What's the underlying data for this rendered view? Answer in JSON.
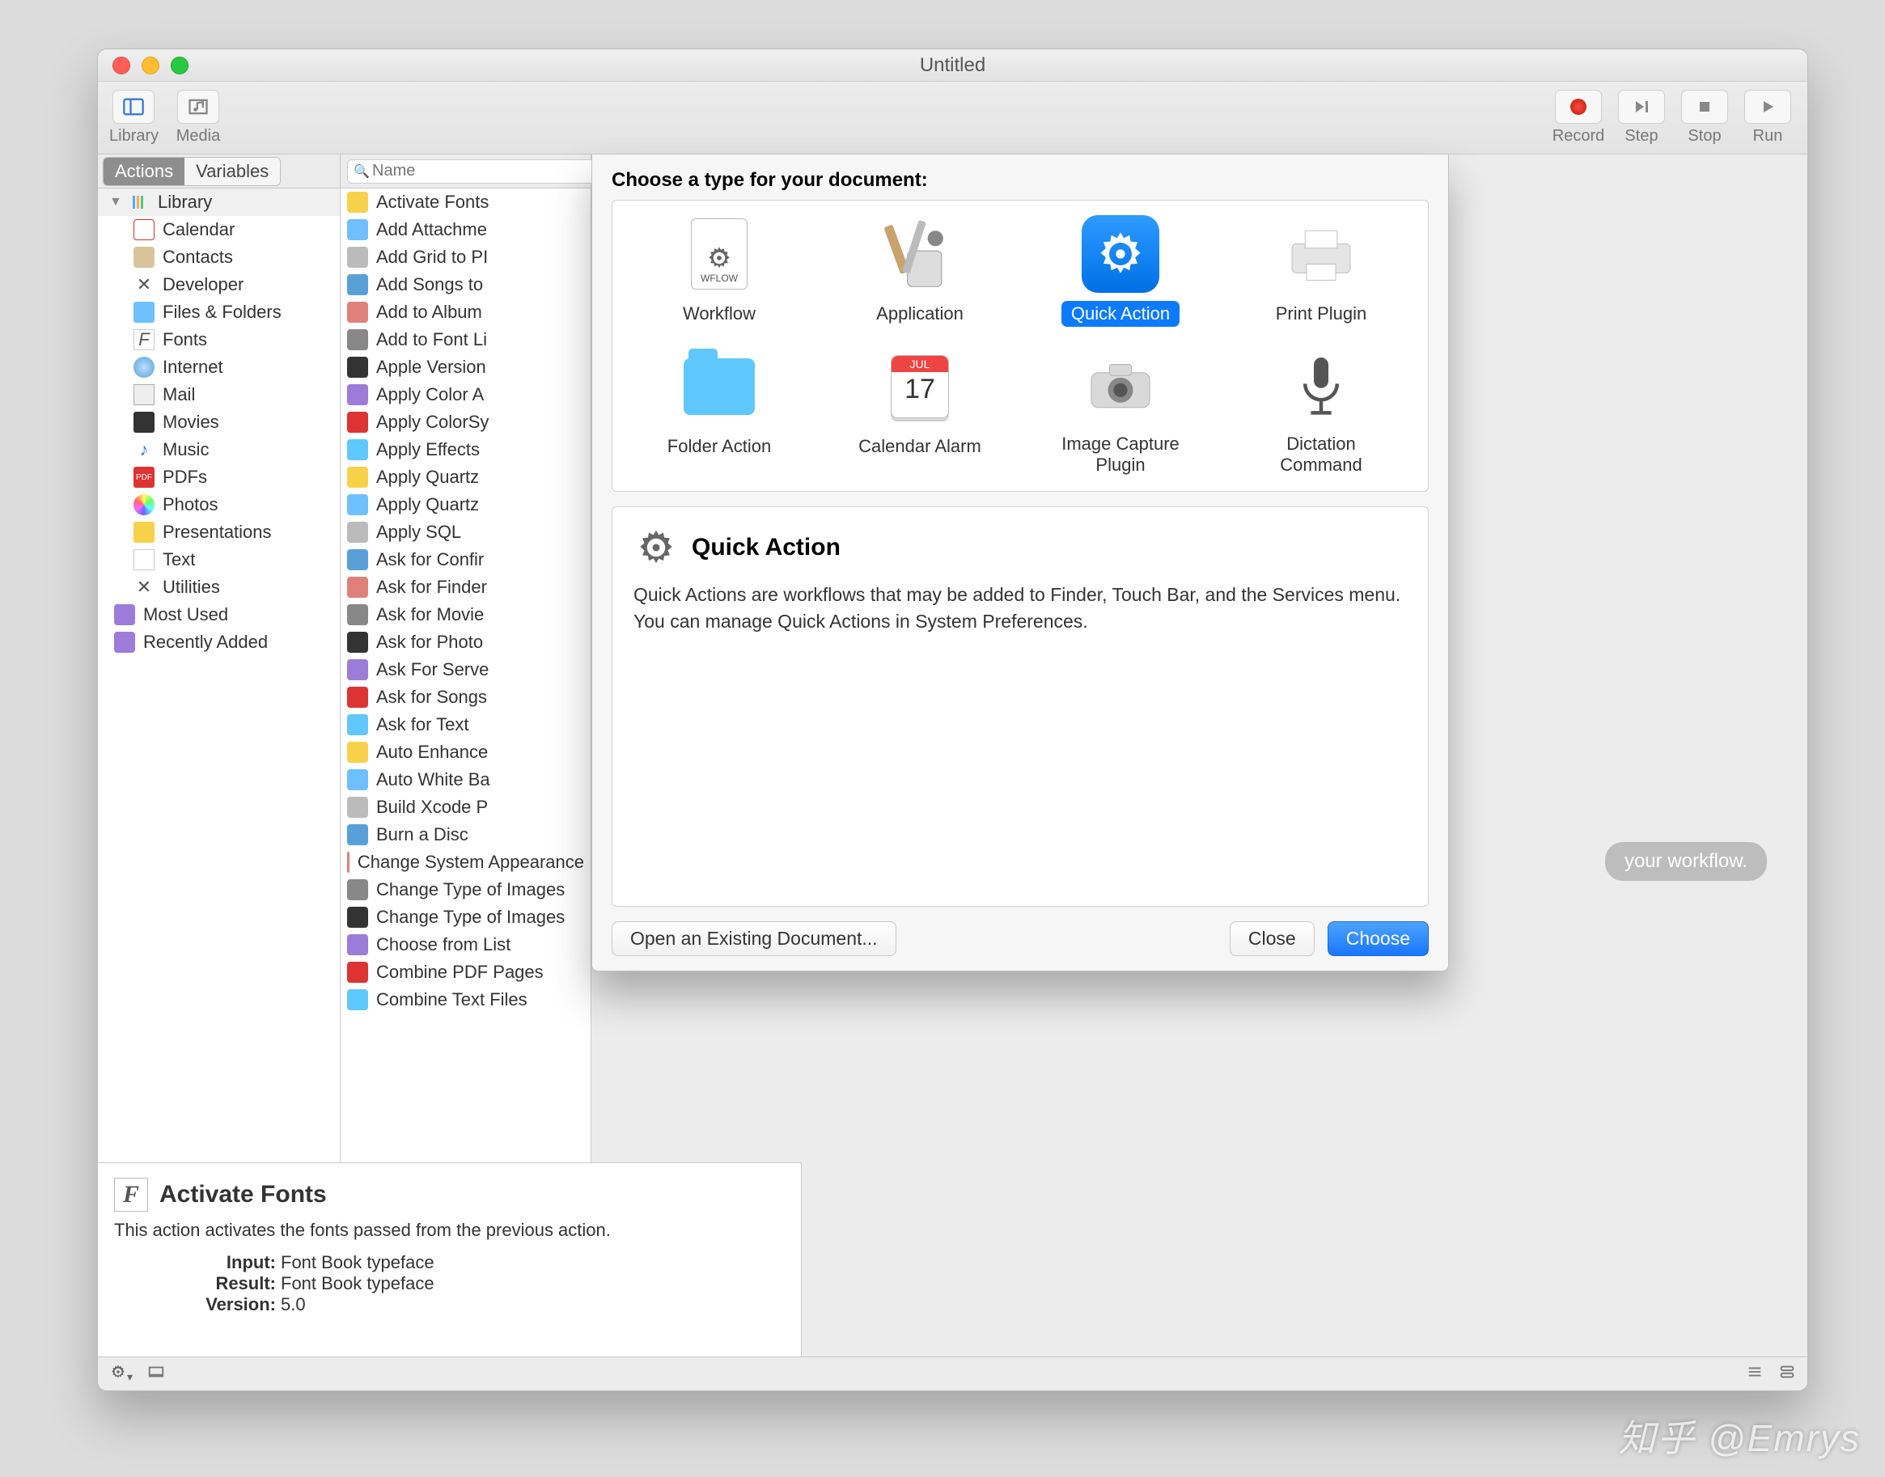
{
  "window": {
    "title": "Untitled"
  },
  "toolbar": {
    "library": "Library",
    "media": "Media",
    "record": "Record",
    "step": "Step",
    "stop": "Stop",
    "run": "Run"
  },
  "segtabs": {
    "actions": "Actions",
    "variables": "Variables"
  },
  "search": {
    "placeholder": "Name"
  },
  "library_tree": {
    "root": "Library",
    "items": [
      "Calendar",
      "Contacts",
      "Developer",
      "Files & Folders",
      "Fonts",
      "Internet",
      "Mail",
      "Movies",
      "Music",
      "PDFs",
      "Photos",
      "Presentations",
      "Text",
      "Utilities"
    ],
    "most_used": "Most Used",
    "recently_added": "Recently Added"
  },
  "actions_list": [
    "Activate Fonts",
    "Add Attachme",
    "Add Grid to PI",
    "Add Songs to",
    "Add to Album",
    "Add to Font Li",
    "Apple Version",
    "Apply Color A",
    "Apply ColorSy",
    "Apply Effects",
    "Apply Quartz",
    "Apply Quartz",
    "Apply SQL",
    "Ask for Confir",
    "Ask for Finder",
    "Ask for Movie",
    "Ask for Photo",
    "Ask For Serve",
    "Ask for Songs",
    "Ask for Text",
    "Auto Enhance",
    "Auto White Ba",
    "Build Xcode P",
    "Burn a Disc",
    "Change System Appearance",
    "Change Type of Images",
    "Change Type of Images",
    "Choose from List",
    "Combine PDF Pages",
    "Combine Text Files"
  ],
  "canvas": {
    "hint": "your workflow."
  },
  "info": {
    "title": "Activate Fonts",
    "desc": "This action activates the fonts passed from the previous action.",
    "input_label": "Input:",
    "input_value": "Font Book typeface",
    "result_label": "Result:",
    "result_value": "Font Book typeface",
    "version_label": "Version:",
    "version_value": "5.0"
  },
  "sheet": {
    "heading": "Choose a type for your document:",
    "types": {
      "workflow": "Workflow",
      "application": "Application",
      "quick_action": "Quick Action",
      "print_plugin": "Print Plugin",
      "folder_action": "Folder Action",
      "calendar_alarm": "Calendar Alarm",
      "image_capture_1": "Image Capture",
      "image_capture_2": "Plugin",
      "dictation_1": "Dictation",
      "dictation_2": "Command"
    },
    "calendar": {
      "month": "JUL",
      "day": "17"
    },
    "wflow_ext": "WFLOW",
    "desc_title": "Quick Action",
    "desc_body": "Quick Actions are workflows that may be added to Finder, Touch Bar, and the Services menu. You can manage Quick Actions in System Preferences.",
    "open_existing": "Open an Existing Document...",
    "close": "Close",
    "choose": "Choose"
  },
  "watermark": "知乎 @Emrys"
}
